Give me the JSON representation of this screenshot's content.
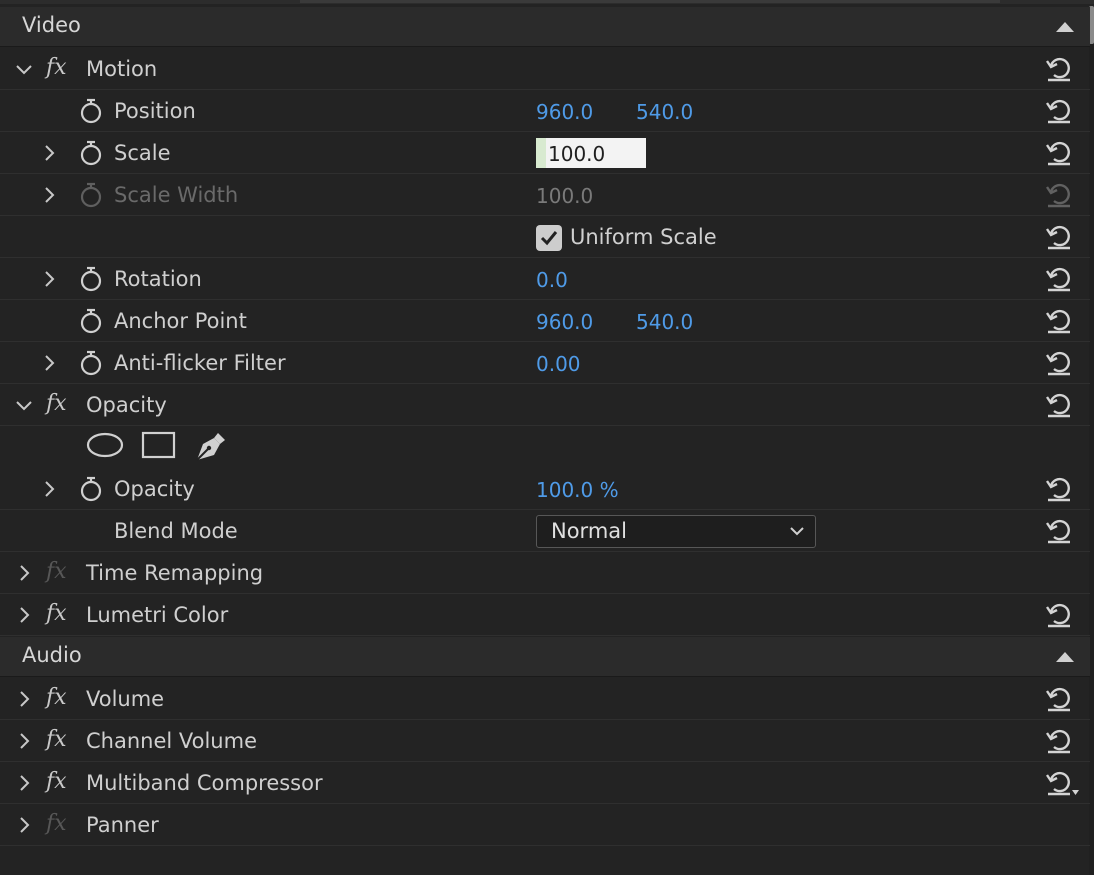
{
  "video": {
    "title": "Video",
    "motion": {
      "label": "Motion",
      "position": {
        "label": "Position",
        "x": "960.0",
        "y": "540.0"
      },
      "scale": {
        "label": "Scale",
        "value": "100.0"
      },
      "scale_width": {
        "label": "Scale Width",
        "value": "100.0"
      },
      "uniform_scale": {
        "label": "Uniform Scale",
        "checked": true
      },
      "rotation": {
        "label": "Rotation",
        "value": "0.0"
      },
      "anchor_point": {
        "label": "Anchor Point",
        "x": "960.0",
        "y": "540.0"
      },
      "anti_flicker": {
        "label": "Anti-flicker Filter",
        "value": "0.00"
      }
    },
    "opacity": {
      "label": "Opacity",
      "mask_tools": [
        "ellipse-mask-icon",
        "rectangle-mask-icon",
        "pen-mask-icon"
      ],
      "opacity_param": {
        "label": "Opacity",
        "value": "100.0 %"
      },
      "blend_mode": {
        "label": "Blend Mode",
        "value": "Normal"
      }
    },
    "time_remapping": {
      "label": "Time Remapping"
    },
    "lumetri_color": {
      "label": "Lumetri Color"
    }
  },
  "audio": {
    "title": "Audio",
    "volume": {
      "label": "Volume"
    },
    "channel_volume": {
      "label": "Channel Volume"
    },
    "multiband_compressor": {
      "label": "Multiband Compressor"
    },
    "panner": {
      "label": "Panner"
    }
  },
  "colors": {
    "background": "#232323",
    "value_blue": "#4f9be8",
    "header": "#2b2b2b"
  }
}
